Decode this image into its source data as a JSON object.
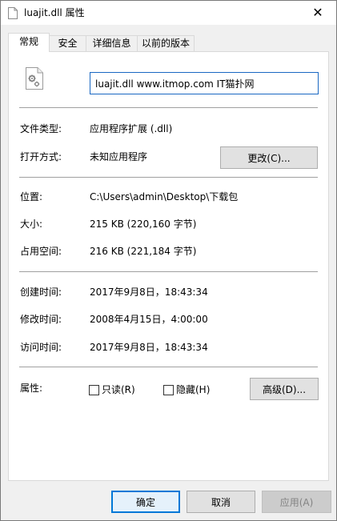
{
  "window": {
    "title": "luajit.dll 属性",
    "close_glyph": "✕"
  },
  "tabs": [
    {
      "label": "常规",
      "active": true
    },
    {
      "label": "安全",
      "active": false
    },
    {
      "label": "详细信息",
      "active": false
    },
    {
      "label": "以前的版本",
      "active": false
    }
  ],
  "general": {
    "file_icon": "dll-gear-file-icon",
    "file_name": "luajit.dll www.itmop.com IT猫扑网",
    "type_label": "文件类型:",
    "type_value": "应用程序扩展 (.dll)",
    "opens_with_label": "打开方式:",
    "opens_with_value": "未知应用程序",
    "change_button": "更改(C)...",
    "location_label": "位置:",
    "location_value": "C:\\Users\\admin\\Desktop\\下载包",
    "size_label": "大小:",
    "size_value": "215 KB (220,160 字节)",
    "size_on_disk_label": "占用空间:",
    "size_on_disk_value": "216 KB (221,184 字节)",
    "created_label": "创建时间:",
    "created_value": "2017年9月8日，18:43:34",
    "modified_label": "修改时间:",
    "modified_value": "2008年4月15日，4:00:00",
    "accessed_label": "访问时间:",
    "accessed_value": "2017年9月8日，18:43:34",
    "attributes_label": "属性:",
    "readonly_label": "只读(R)",
    "readonly_checked": false,
    "hidden_label": "隐藏(H)",
    "hidden_checked": false,
    "advanced_button": "高级(D)..."
  },
  "footer": {
    "ok_button": "确定",
    "cancel_button": "取消",
    "apply_button": "应用(A)"
  },
  "colors": {
    "accent": "#0078d7",
    "focus_border": "#1a68c2",
    "disabled_bg": "#cccccc"
  }
}
